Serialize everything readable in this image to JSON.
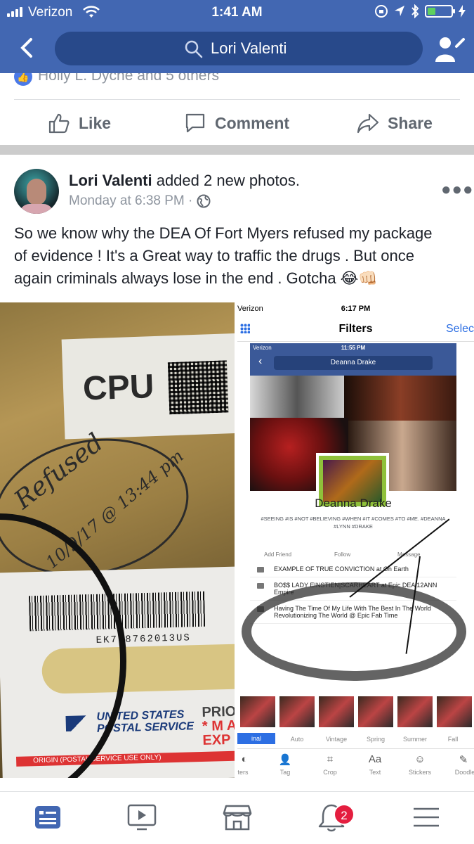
{
  "status_bar": {
    "carrier": "Verizon",
    "time": "1:41 AM",
    "battery_level": 0.35
  },
  "nav": {
    "search_text": "Lori Valenti"
  },
  "reactions": {
    "text": "Holly L. Dyche and 5 others"
  },
  "actions": {
    "like": "Like",
    "comment": "Comment",
    "share": "Share"
  },
  "post": {
    "author": "Lori Valenti",
    "action": " added 2 new photos.",
    "timestamp": "Monday at 6:38 PM · ",
    "text_lines": [
      "So we know why the DEA Of Fort Myers refused my package",
      "of evidence ! It's a Great way to traffic the drugs . But once",
      "again criminals always lose in the end .  Gotcha 😂👊🏻"
    ]
  },
  "photo_left": {
    "cpu": "CPU",
    "refused": "Refused",
    "refused_date": "10/9/17 @ 13:44 pm",
    "barcode_number": "EK768762013US",
    "usps_line1": "UNITED STATES",
    "usps_line2": "POSTAL SERVICE",
    "priority_line1": "PRIO",
    "priority_line2": "* M A",
    "priority_line3": "EXP",
    "origin": "ORIGIN (POSTAL SERVICE USE ONLY)"
  },
  "photo_right": {
    "status_carrier": "Verizon",
    "status_time": "6:17 PM",
    "title": "Filters",
    "select": "Selec",
    "inner_status_carrier": "Verizon",
    "inner_status_time": "11:55 PM",
    "inner_search": "Deanna Drake",
    "profile_name": "Deanna Drake",
    "hashtags": "#SEEING #IS #NOT #BELIEVING #WHEN #IT #COMES #TO #ME. #DEANNA #LYNN #DRAKE",
    "actions": [
      "Add Friend",
      "Follow",
      "Message"
    ],
    "rows": [
      "EXAMPLE OF TRUE CONVICTION at On Earth",
      "BO$$ LADY EINSTIEN|SCARHEART at Epic DEA 12ANN Empire",
      "Having The Time Of My Life With The Best In The World Revolutionizing The World @ Epic Fab Time"
    ],
    "filters": [
      "inal",
      "Auto",
      "Vintage",
      "Spring",
      "Summer",
      "Fall"
    ],
    "tools": [
      "ters",
      "Tag",
      "Crop",
      "Text",
      "Stickers",
      "Doodle"
    ]
  },
  "tabbar": {
    "notification_count": "2"
  },
  "colors": {
    "facebook_blue": "#4267b2",
    "search_bg": "#28498a",
    "badge_red": "#e41e3f"
  }
}
